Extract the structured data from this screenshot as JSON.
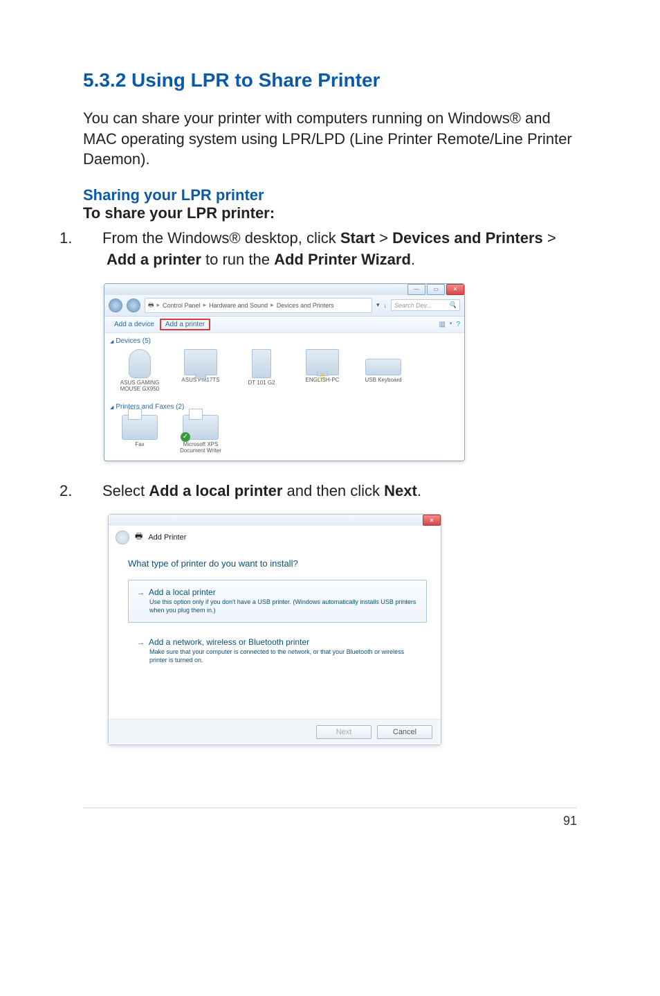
{
  "heading": "5.3.2  Using LPR to Share Printer",
  "intro": "You can share your printer with computers running on Windows® and MAC operating system using LPR/LPD (Line Printer Remote/Line Printer Daemon).",
  "subheading_blue": "Sharing your LPR printer",
  "subheading_bold": "To share your LPR printer:",
  "step1": {
    "num": "1.",
    "prefix": "From the Windows® desktop, click ",
    "b1": "Start",
    "gt1": " > ",
    "b2": "Devices and Printers",
    "gt2": " > ",
    "b3": "Add a printer",
    "mid": " to run the ",
    "b4": "Add Printer Wizard",
    "suffix": "."
  },
  "screenshot1": {
    "breadcrumb": {
      "root_icon": "🖶",
      "parts": [
        "Control Panel",
        "Hardware and Sound",
        "Devices and Printers"
      ]
    },
    "search_placeholder": "Search Dev...",
    "refresh_icon": "↓",
    "toolbar": {
      "add_device": "Add a device",
      "add_printer": "Add a printer",
      "view_icon": "▥",
      "help_icon": "?"
    },
    "groups": [
      {
        "title": "Devices (5)",
        "items": [
          {
            "label": "ASUS GAMING MOUSE GX950",
            "type": "mouse"
          },
          {
            "label": "ASUS PM17TS",
            "type": "monitor"
          },
          {
            "label": "DT 101 G2",
            "type": "tower"
          },
          {
            "label": "ENGLISH-PC",
            "type": "monitor warn"
          },
          {
            "label": "USB Keyboard",
            "type": "kbd"
          }
        ]
      },
      {
        "title": "Printers and Faxes (2)",
        "items": [
          {
            "label": "Fax",
            "type": "fax"
          },
          {
            "label": "Microsoft XPS Document Writer",
            "type": "fax check"
          }
        ]
      }
    ]
  },
  "step2": {
    "num": "2.",
    "prefix": "Select ",
    "b1": "Add a local printer",
    "mid": " and then click ",
    "b2": "Next",
    "suffix": "."
  },
  "screenshot2": {
    "title": "Add Printer",
    "question": "What type of printer do you want to install?",
    "option1": {
      "title": "Add a local printer",
      "desc": "Use this option only if you don't have a USB printer. (Windows automatically installs USB printers when you plug them in.)"
    },
    "option2": {
      "title": "Add a network, wireless or Bluetooth printer",
      "desc": "Make sure that your computer is connected to the network, or that your Bluetooth or wireless printer is turned on."
    },
    "buttons": {
      "next": "Next",
      "cancel": "Cancel"
    }
  },
  "page_number": "91"
}
